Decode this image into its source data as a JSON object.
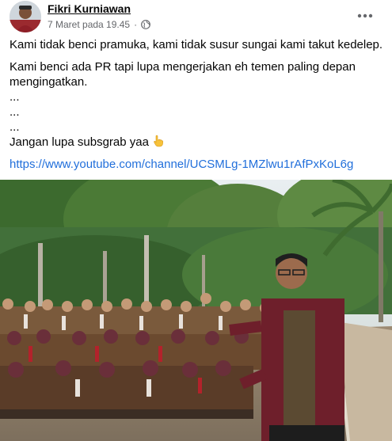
{
  "post": {
    "author": "Fikri Kurniawan",
    "timestamp": "7 Maret pada 19.45",
    "separator": "·",
    "privacy_icon": "globe-icon",
    "more_icon": "more-horizontal-icon",
    "lines": [
      "Kami tidak benci pramuka, kami tidak susur sungai kami takut kedelep.",
      "Kami benci ada PR tapi lupa mengerjakan eh temen paling depan mengingatkan.",
      "...",
      "...",
      "...",
      "Jangan lupa subsgrab yaa"
    ],
    "emoji_icon": "pointing-down-hand-icon",
    "link": "https://www.youtube.com/channel/UCSMLg-1MZlwu1rAfPxKoL6g"
  },
  "colors": {
    "link": "#216fdb",
    "meta": "#65676b",
    "text": "#050505"
  }
}
